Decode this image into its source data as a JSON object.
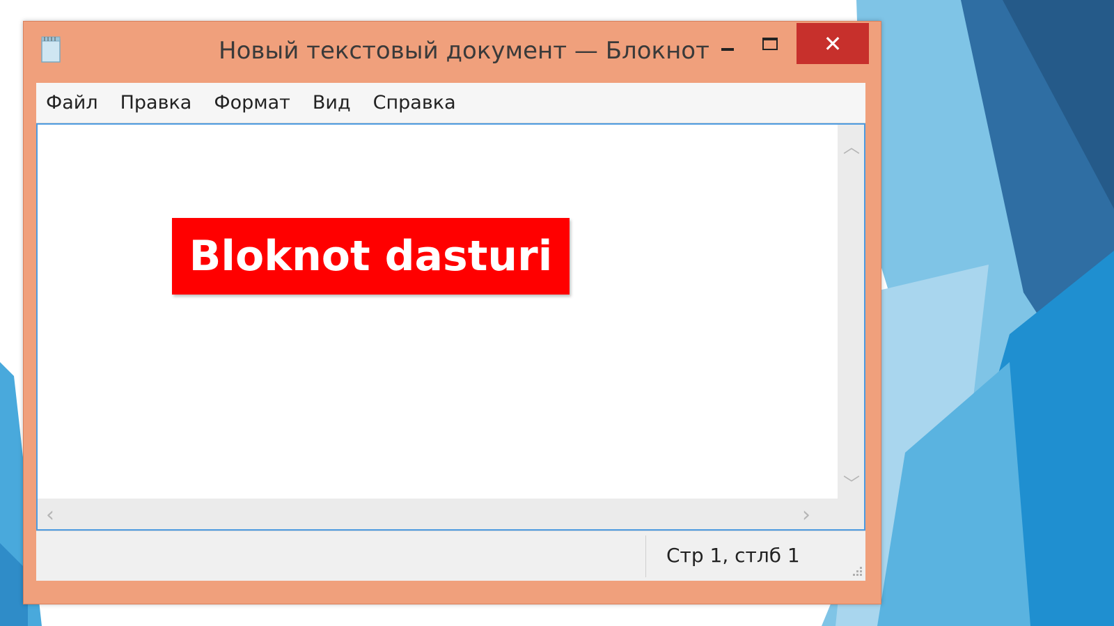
{
  "window": {
    "title": "Новый текстовый документ — Блокнот",
    "close_glyph": "✕",
    "icons": {
      "app": "notepad-icon",
      "minimize": "minimize-icon",
      "maximize": "maximize-icon",
      "close": "close-icon"
    }
  },
  "menu": {
    "items": [
      "Файл",
      "Правка",
      "Формат",
      "Вид",
      "Справка"
    ]
  },
  "editor": {
    "banner_text": "Bloknot dasturi",
    "banner_color": "#ff0000",
    "scroll_up": "︿",
    "scroll_down": "﹀",
    "scroll_left": "‹",
    "scroll_right": "›"
  },
  "status": {
    "position": "Стр 1, стлб 1"
  },
  "colors": {
    "frame": "#f0a07c",
    "close_button": "#c7302c",
    "editor_border": "#4d9be0"
  }
}
